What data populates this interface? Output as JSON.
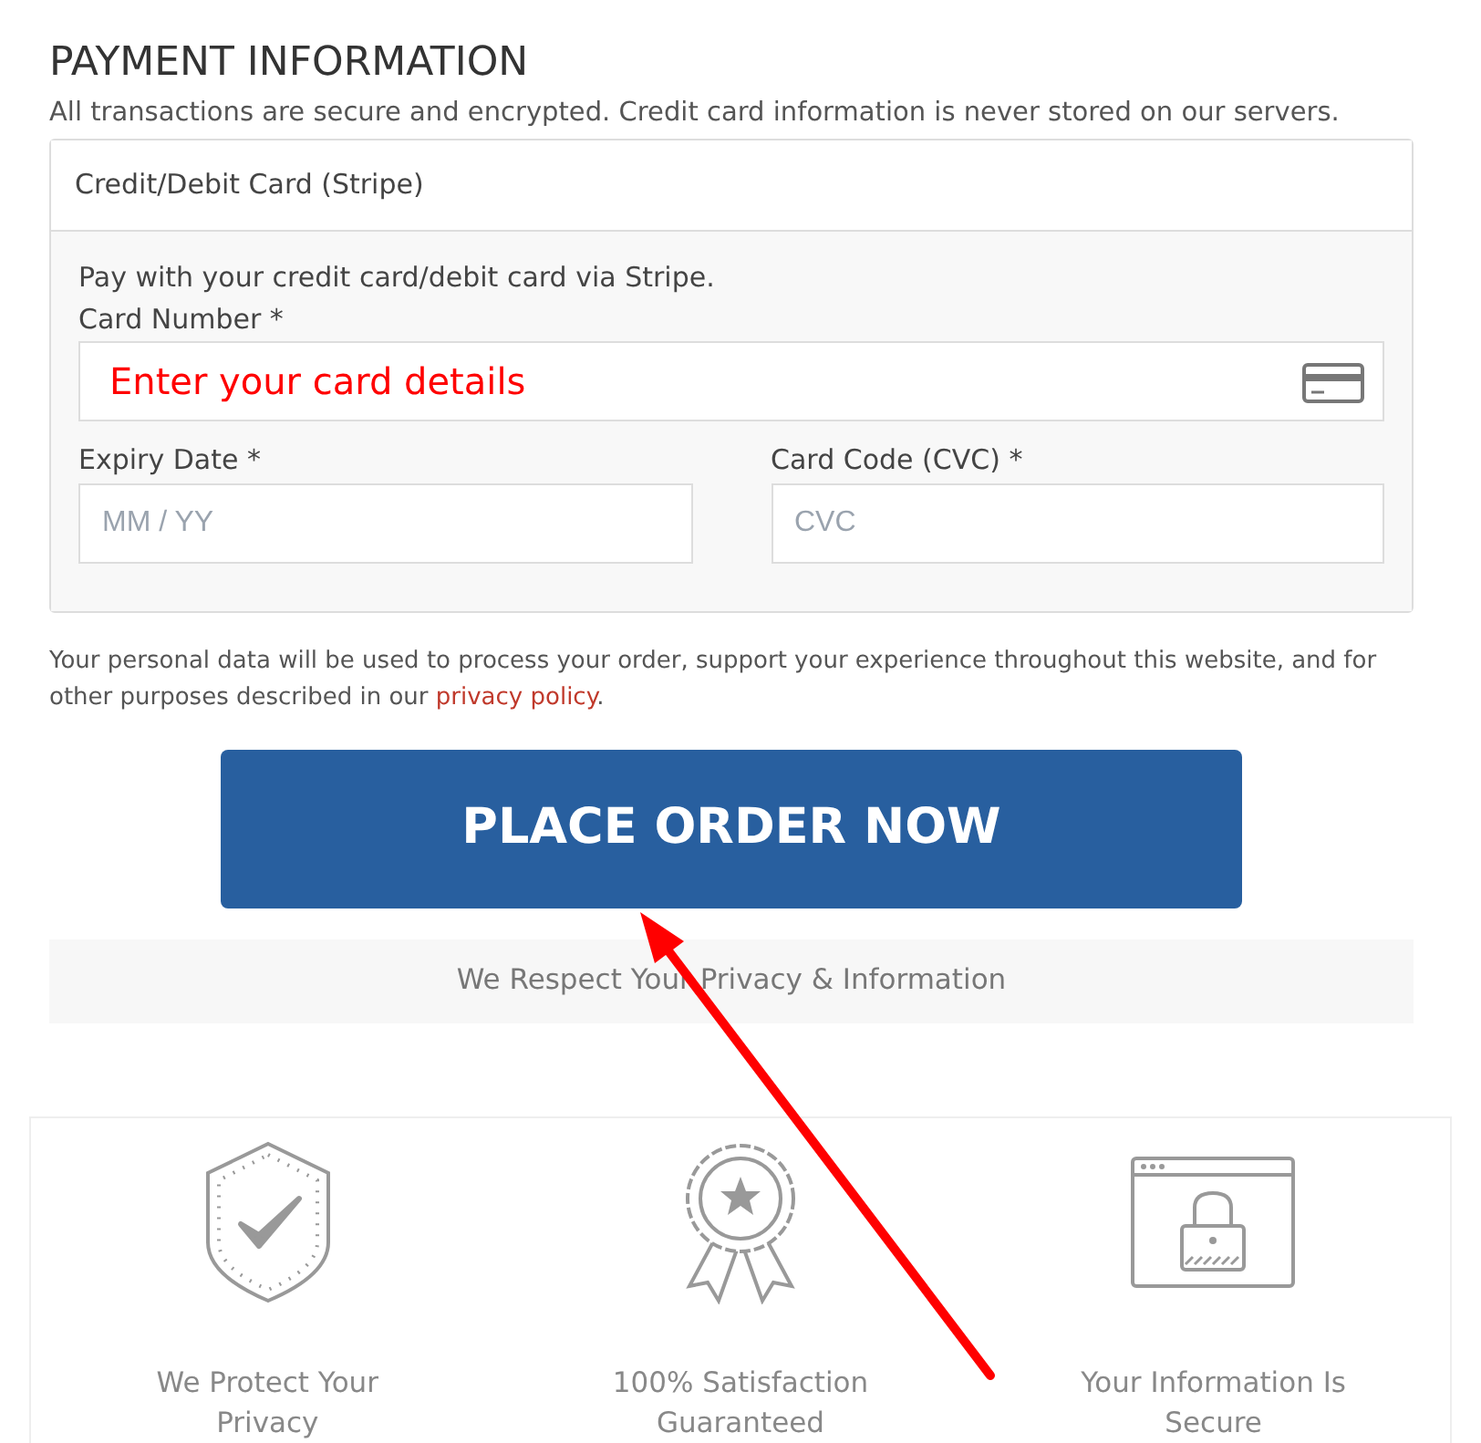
{
  "heading": "PAYMENT INFORMATION",
  "subheading": "All transactions are secure and encrypted. Credit card information is never stored on our servers.",
  "method": {
    "title": "Credit/Debit Card (Stripe)",
    "description": "Pay with your credit card/debit card via Stripe.",
    "fields": [
      {
        "label": "Card Number *",
        "annotation": "Enter your card details",
        "kind": "card"
      },
      {
        "label": "Expiry Date *",
        "placeholder": "MM / YY",
        "kind": "half"
      },
      {
        "label": "Card Code (CVC) *",
        "placeholder": "CVC",
        "kind": "half"
      }
    ]
  },
  "privacy_note": {
    "text": "Your personal data will be used to process your order, support your experience throughout this website, and for other purposes described in our",
    "link": "privacy policy",
    "end": "."
  },
  "order_button": "PLACE ORDER NOW",
  "privacy_banner": "We Respect Your Privacy & Information",
  "features": [
    {
      "kind": "shield",
      "title": "We Protect Your Privacy"
    },
    {
      "kind": "ribbon",
      "title": "100% Satisfaction Guaranteed"
    },
    {
      "kind": "lock",
      "title": "Your Information Is Secure"
    }
  ]
}
